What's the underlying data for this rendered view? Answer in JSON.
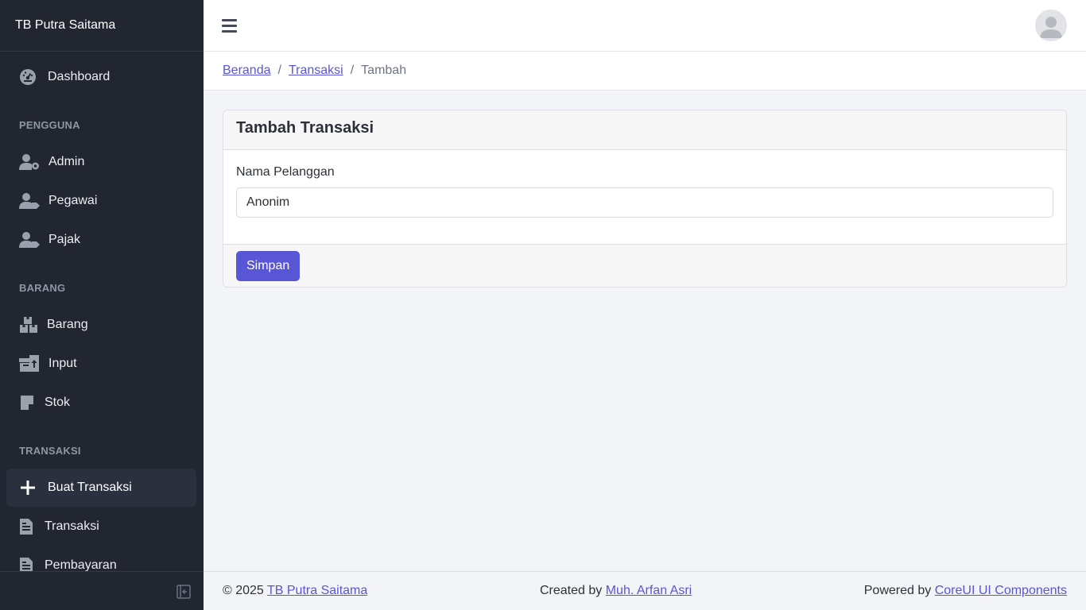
{
  "sidebar": {
    "brand": "TB Putra Saitama",
    "dashboard": "Dashboard",
    "section_pengguna": "PENGGUNA",
    "admin": "Admin",
    "pegawai": "Pegawai",
    "pajak": "Pajak",
    "section_barang": "BARANG",
    "barang": "Barang",
    "input": "Input",
    "stok": "Stok",
    "section_transaksi": "TRANSAKSI",
    "buat_transaksi": "Buat Transaksi",
    "transaksi": "Transaksi",
    "pembayaran": "Pembayaran"
  },
  "breadcrumb": {
    "home": "Beranda",
    "transaksi": "Transaksi",
    "current": "Tambah",
    "separator": "/"
  },
  "card": {
    "title": "Tambah Transaksi",
    "customer_label": "Nama Pelanggan",
    "customer_value": "Anonim",
    "save_label": "Simpan"
  },
  "footer": {
    "copyright": "© 2025",
    "brand_link": "TB Putra Saitama",
    "created_by": "Created by",
    "author_link": "Muh. Arfan Asri",
    "powered_by": "Powered by",
    "powered_link": "CoreUI UI Components"
  },
  "colors": {
    "sidebar_bg": "#212631",
    "primary": "#5856d6",
    "page_bg": "#f3f4f7"
  }
}
